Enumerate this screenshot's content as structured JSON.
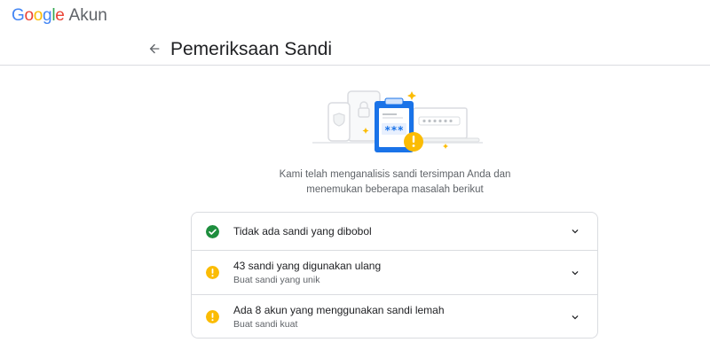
{
  "app": {
    "logo_google": "Google",
    "logo_product": "Akun",
    "logo_colors": [
      "#4285F4",
      "#EA4335",
      "#FBBC05",
      "#4285F4",
      "#34A853",
      "#EA4335"
    ]
  },
  "header": {
    "back_icon": "arrow-left-icon",
    "title": "Pemeriksaan Sandi"
  },
  "illustration": {
    "icon": "password-checkup-clipboard-illustration",
    "masked_password": "***",
    "accent": "#1a73e8",
    "warning_color": "#fbbc04"
  },
  "intro": {
    "line1": "Kami telah menganalisis sandi tersimpan Anda dan",
    "line2": "menemukan beberapa masalah berikut"
  },
  "checks": [
    {
      "title": "Tidak ada sandi yang dibobol",
      "subtitle": "",
      "status": "ok",
      "status_icon": "check-circle-icon",
      "color": "#1e8e3e"
    },
    {
      "title": "43 sandi yang digunakan ulang",
      "subtitle": "Buat sandi yang unik",
      "status": "warning",
      "status_icon": "warning-circle-icon",
      "color": "#fbbc04"
    },
    {
      "title": "Ada 8 akun yang menggunakan sandi lemah",
      "subtitle": "Buat sandi kuat",
      "status": "warning",
      "status_icon": "warning-circle-icon",
      "color": "#fbbc04"
    }
  ]
}
